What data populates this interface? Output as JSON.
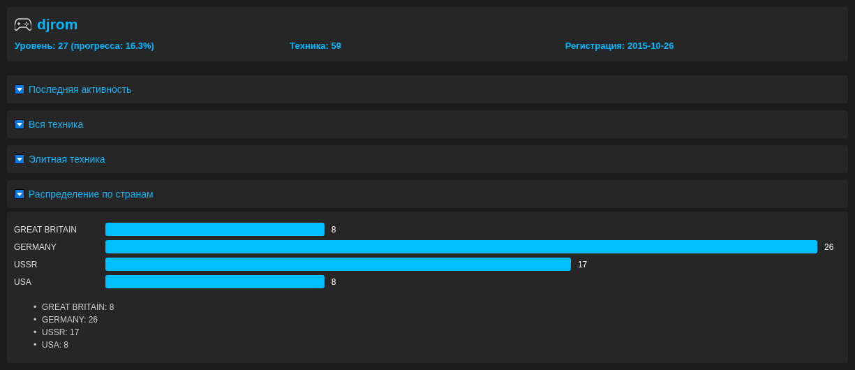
{
  "profile": {
    "name": "djrom",
    "stats": [
      "Уровень: 27 (прогресса: 16.3%)",
      "Техника: 59",
      "Регистрация: 2015-10-26"
    ]
  },
  "sections": [
    {
      "title": "Последняя активность"
    },
    {
      "title": "Вся техника"
    },
    {
      "title": "Элитная техника"
    },
    {
      "title": "Распределение по странам",
      "chart_data": {
        "type": "bar",
        "orientation": "horizontal",
        "categories": [
          "GREAT BRITAIN",
          "GERMANY",
          "USSR",
          "USA"
        ],
        "series": [
          {
            "color": "#00bfff",
            "values": [
              8,
              26,
              17,
              8
            ]
          }
        ],
        "data_labels": true
      },
      "list_marker": "•",
      "list": [
        "GREAT BRITAIN: 8",
        "GERMANY: 26",
        "USSR: 17",
        "USA: 8"
      ]
    }
  ]
}
